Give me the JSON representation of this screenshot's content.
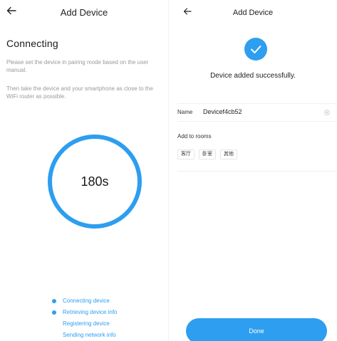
{
  "left": {
    "header": {
      "title": "Add Device",
      "back_icon": "arrow-left-icon"
    },
    "heading": "Connecting",
    "hint1": "Please set the device in pairing mode based on the user manual.",
    "hint2": "Then take the device and your smartphone as close to the WiFi router as possible.",
    "countdown": "180s",
    "steps": [
      {
        "label": "Connecting device",
        "done": true
      },
      {
        "label": "Retrieving device info",
        "done": true
      },
      {
        "label": "Registering device",
        "done": false
      },
      {
        "label": "Sending network info",
        "done": false
      }
    ]
  },
  "right": {
    "header": {
      "title": "Add Device",
      "back_icon": "arrow-left-icon"
    },
    "success_icon": "check-icon",
    "success_text": "Device added successfully.",
    "name_label": "Name",
    "name_value": "Devicef4cb52",
    "clear_icon": "clear-circle-icon",
    "rooms_label": "Add to rooms",
    "rooms": [
      "客厅",
      "卧室",
      "其他"
    ],
    "done_label": "Done"
  },
  "colors": {
    "accent": "#2d9ef0",
    "text": "#1f1f1f",
    "hint": "#9a9a9a",
    "background": "#ffffff"
  }
}
